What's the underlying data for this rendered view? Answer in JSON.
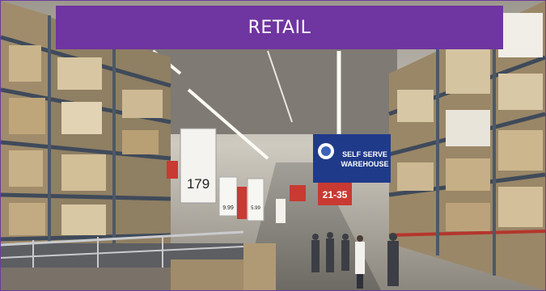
{
  "banner": {
    "title": "RETAIL",
    "color": "#6f35a0"
  },
  "signs": {
    "left_price": "179",
    "mid_price_a": "9.99",
    "mid_price_b": "5.99",
    "warehouse_line1": "SELF SERVE",
    "warehouse_line2": "WAREHOUSE",
    "aisle_range": "21-35"
  }
}
